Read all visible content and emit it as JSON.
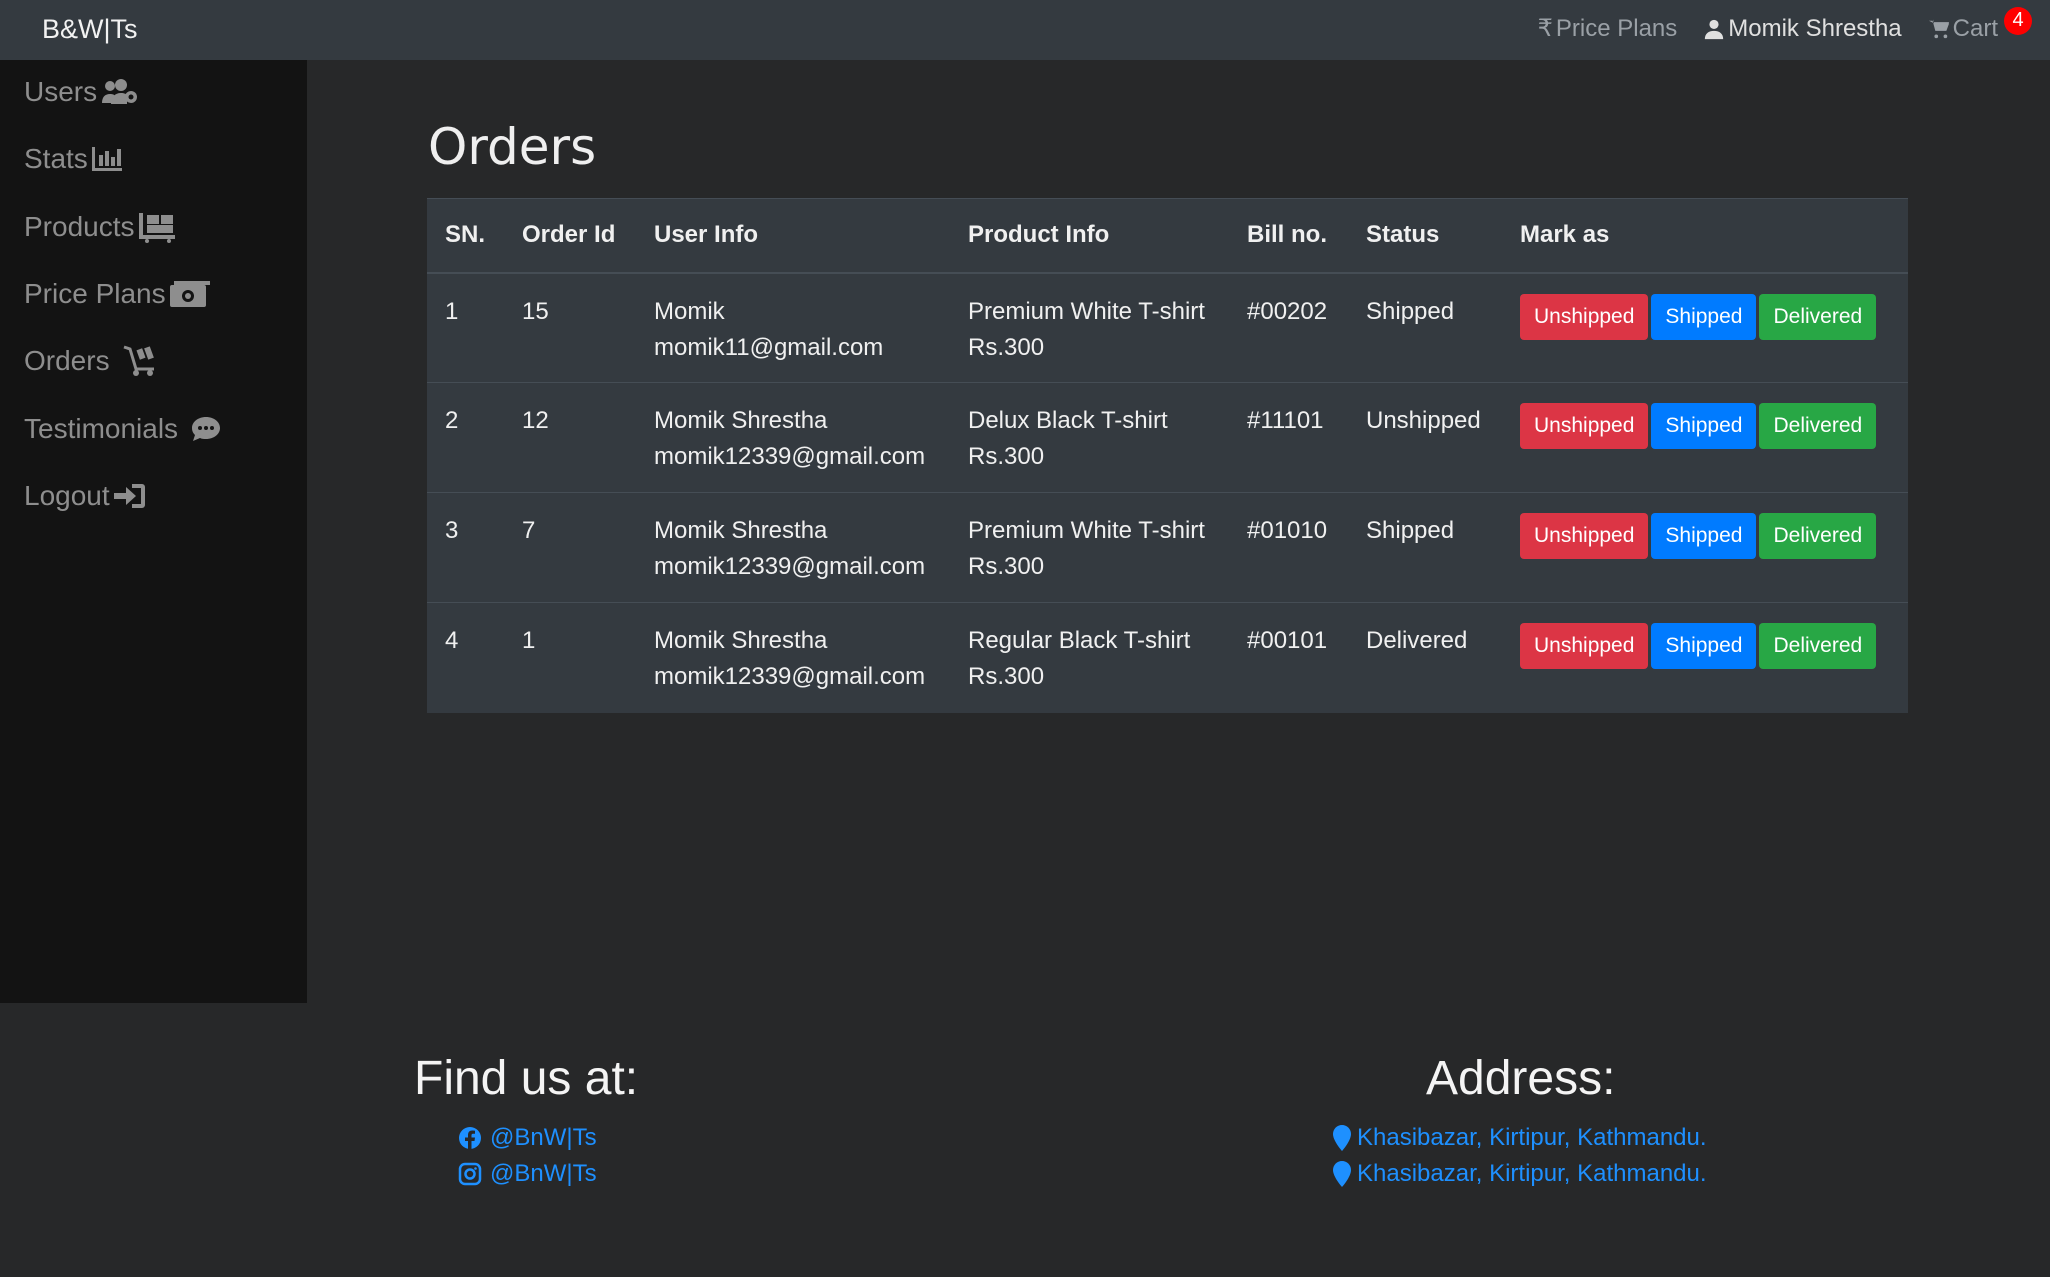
{
  "navbar": {
    "brand": "B&W|Ts",
    "price_plans": "Price Plans",
    "user": "Momik Shrestha",
    "cart": "Cart",
    "cart_count": "4"
  },
  "sidebar": {
    "items": [
      {
        "label": "Users",
        "icon": "users-cog-icon"
      },
      {
        "label": "Stats",
        "icon": "chart-bar-icon"
      },
      {
        "label": "Products",
        "icon": "dolly-icon"
      },
      {
        "label": "Price Plans",
        "icon": "money-bill-icon"
      },
      {
        "label": "Orders",
        "icon": "cart-dolly-icon"
      },
      {
        "label": "Testimonials",
        "icon": "comment-icon"
      },
      {
        "label": "Logout",
        "icon": "sign-out-icon"
      }
    ]
  },
  "main": {
    "title": "Orders",
    "columns": [
      "SN.",
      "Order Id",
      "User Info",
      "Product Info",
      "Bill no.",
      "Status",
      "Mark as"
    ],
    "rows": [
      {
        "sn": "1",
        "order_id": "15",
        "user_name": "Momik",
        "user_email": "momik11@gmail.com",
        "product": "Premium White T-shirt",
        "price": "Rs.300",
        "bill": "#00202",
        "status": "Shipped"
      },
      {
        "sn": "2",
        "order_id": "12",
        "user_name": "Momik Shrestha",
        "user_email": "momik12339@gmail.com",
        "product": "Delux Black T-shirt",
        "price": "Rs.300",
        "bill": "#11101",
        "status": "Unshipped"
      },
      {
        "sn": "3",
        "order_id": "7",
        "user_name": "Momik Shrestha",
        "user_email": "momik12339@gmail.com",
        "product": "Premium White T-shirt",
        "price": "Rs.300",
        "bill": "#01010",
        "status": "Shipped"
      },
      {
        "sn": "4",
        "order_id": "1",
        "user_name": "Momik Shrestha",
        "user_email": "momik12339@gmail.com",
        "product": "Regular Black T-shirt",
        "price": "Rs.300",
        "bill": "#00101",
        "status": "Delivered"
      }
    ],
    "buttons": {
      "unshipped": "Unshipped",
      "shipped": "Shipped",
      "delivered": "Delivered"
    }
  },
  "footer": {
    "find_us": "Find us at:",
    "facebook": "@BnW|Ts",
    "instagram": "@BnW|Ts",
    "address_title": "Address:",
    "address1": "Khasibazar, Kirtipur, Kathmandu.",
    "address2": "Khasibazar, Kirtipur, Kathmandu."
  },
  "colors": {
    "danger": "#dc3545",
    "primary": "#007bff",
    "success": "#28a745",
    "link": "#1e90ff"
  }
}
